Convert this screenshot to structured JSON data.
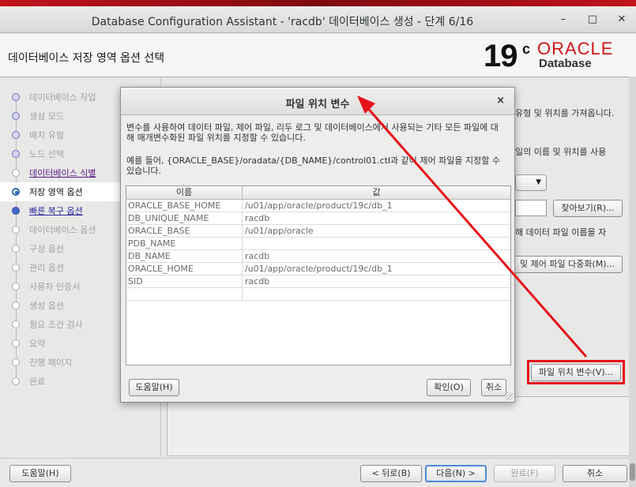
{
  "window": {
    "title": "Database Configuration Assistant - 'racdb' 데이터베이스 생성 - 단계 6/16",
    "minimize": "–",
    "maximize": "□",
    "close": "✕"
  },
  "header": {
    "step_title": "데이터베이스 저장 영역 옵션 선택",
    "logo_version": "19",
    "logo_sup": "c",
    "logo_brand": "ORACLE",
    "logo_product": "Database"
  },
  "sidebar": {
    "steps": [
      {
        "label": "데이터베이스 작업",
        "state": "done"
      },
      {
        "label": "생성 모드",
        "state": "done"
      },
      {
        "label": "배치 유형",
        "state": "done"
      },
      {
        "label": "노드 선택",
        "state": "done"
      },
      {
        "label": "데이터베이스 식별",
        "state": "link"
      },
      {
        "label": "저장 영역 옵션",
        "state": "current"
      },
      {
        "label": "빠른 복구 옵션",
        "state": "active-link"
      },
      {
        "label": "데이터베이스 옵션",
        "state": "pending"
      },
      {
        "label": "구성 옵션",
        "state": "pending"
      },
      {
        "label": "관리 옵션",
        "state": "pending"
      },
      {
        "label": "사용자 인증서",
        "state": "pending"
      },
      {
        "label": "생성 옵션",
        "state": "pending"
      },
      {
        "label": "필요 조건 검사",
        "state": "pending"
      },
      {
        "label": "요약",
        "state": "pending"
      },
      {
        "label": "진행 페이지",
        "state": "pending"
      },
      {
        "label": "완료",
        "state": "pending"
      }
    ]
  },
  "background": {
    "text1": "유형 및 위치를 가져옵니다.",
    "text2": "일의 이름 및 위치를 사용",
    "browse_button": "찾아보기(R)...",
    "text3": "해 데이터 파일 이름을 자",
    "multiplex_button": "및 제어 파일 다중화(M)...",
    "file_location_button": "파일 위치 변수(V)..."
  },
  "footer": {
    "help": "도움말(H)",
    "back": "< 뒤로(B)",
    "next": "다음(N) >",
    "finish": "완료(F)",
    "cancel": "취소"
  },
  "dialog": {
    "title": "파일 위치 변수",
    "close": "×",
    "desc1": "변수를 사용하여 데이터 파일, 제어 파일, 리두 로그 및 데이터베이스에서 사용되는 기타 모든 파일에 대해 매개변수화된 파일 위치를 지정할 수 있습니다.",
    "desc2": "예를 들어, {ORACLE_BASE}/oradata/{DB_NAME}/control01.ctl과 같이 제어 파일을 지정할 수 있습니다.",
    "col_name": "이름",
    "col_value": "값",
    "rows": [
      {
        "name": "ORACLE_BASE_HOME",
        "value": "/u01/app/oracle/product/19c/db_1"
      },
      {
        "name": "DB_UNIQUE_NAME",
        "value": "racdb"
      },
      {
        "name": "ORACLE_BASE",
        "value": "/u01/app/oracle"
      },
      {
        "name": "PDB_NAME",
        "value": ""
      },
      {
        "name": "DB_NAME",
        "value": "racdb"
      },
      {
        "name": "ORACLE_HOME",
        "value": "/u01/app/oracle/product/19c/db_1"
      },
      {
        "name": "SID",
        "value": "racdb"
      },
      {
        "name": "",
        "value": ""
      }
    ],
    "help_button": "도움말(H)",
    "ok_button": "확인(O)",
    "cancel_button": "취소"
  },
  "colors": {
    "annotation": "#e6121a",
    "oracle_red": "#d1161b",
    "accent_bar": "#c3141c"
  }
}
